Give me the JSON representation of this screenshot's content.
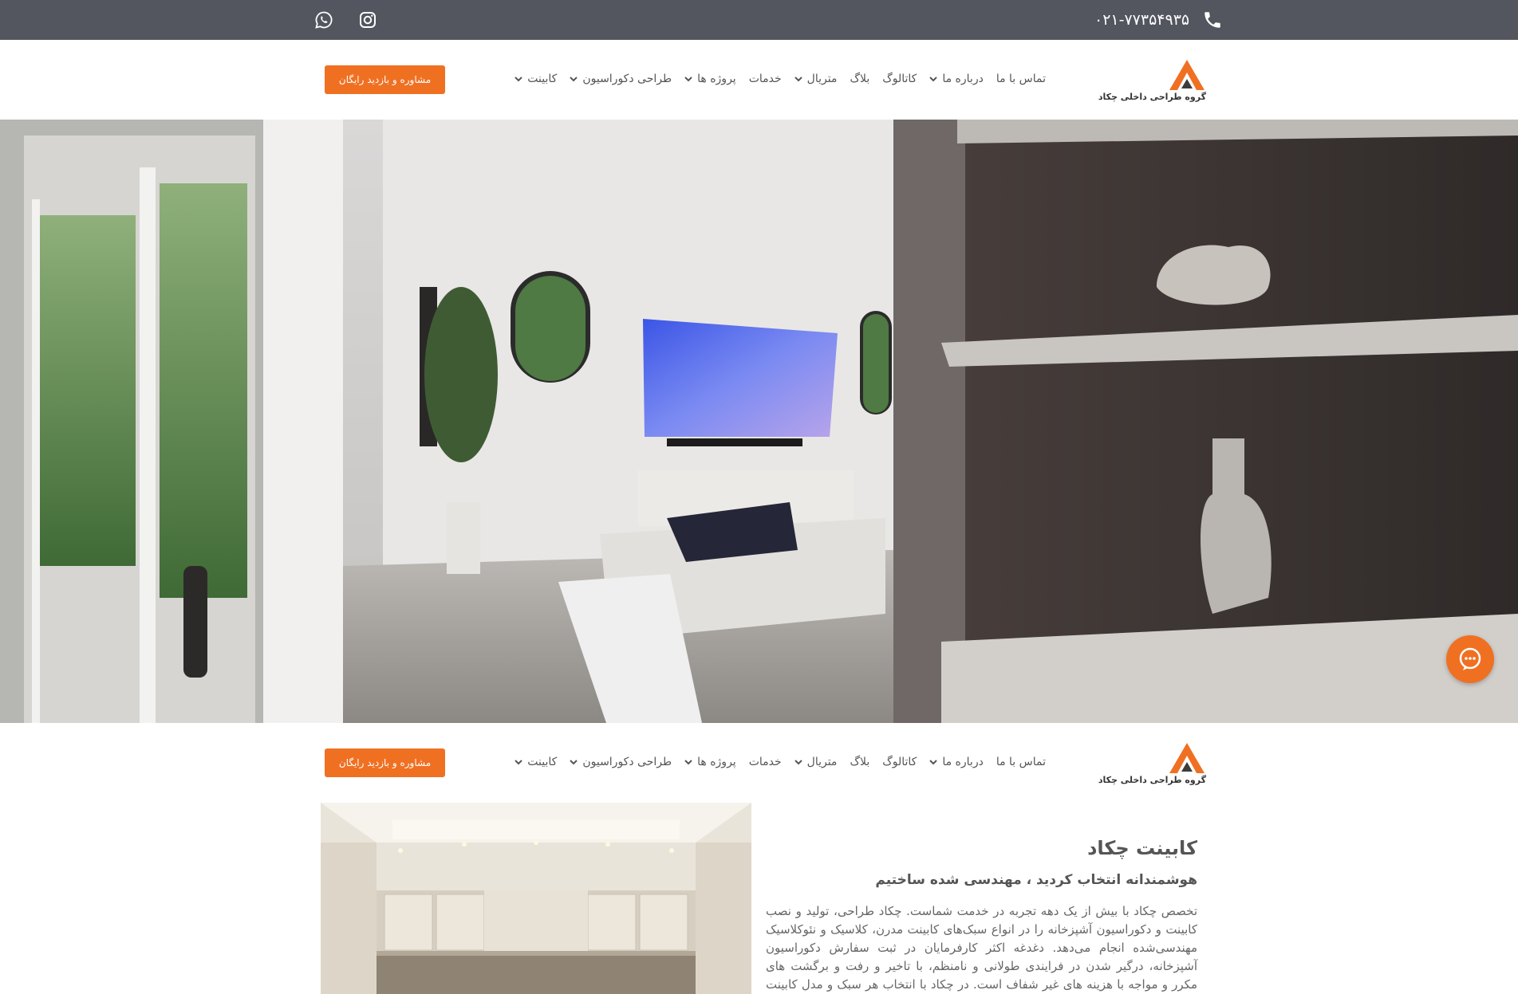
{
  "topbar": {
    "phone": "۰۲۱-۷۷۳۵۴۹۳۵",
    "phone_icon": "phone-icon",
    "social": [
      "instagram-icon",
      "whatsapp-icon"
    ]
  },
  "brand": {
    "name": "گروه طراحی داخلی چکاد",
    "accent": "#f07022"
  },
  "nav": {
    "items": [
      {
        "label": "کابینت",
        "has_dropdown": true
      },
      {
        "label": "طراحی دکوراسیون",
        "has_dropdown": true
      },
      {
        "label": "پروژه ها",
        "has_dropdown": true
      },
      {
        "label": "خدمات",
        "has_dropdown": false
      },
      {
        "label": "متریال",
        "has_dropdown": true
      },
      {
        "label": "بلاگ",
        "has_dropdown": false
      },
      {
        "label": "کاتالوگ",
        "has_dropdown": false
      },
      {
        "label": "درباره ما",
        "has_dropdown": true
      },
      {
        "label": "تماس با ما",
        "has_dropdown": false
      }
    ],
    "cta": "مشاوره و بازدید رایگان"
  },
  "section": {
    "title": "کابینت چکاد",
    "subtitle": "هوشمندانه انتخاب کردید ، مهندسی شده ساختیم",
    "body": "تخصص چکاد با بیش از یک دهه تجربه در خدمت شماست. چکاد طراحی، تولید و نصب کابینت و دکوراسیون آشپزخانه را در انواع سبک‌های کابینت مدرن، کلاسیک و نئوکلاسیک مهندسی‌شده انجام می‌دهد. دغدغه اکثر کارفرمایان در ثبت سفارش دکوراسیون آشپزخانه، درگیر شدن در فرایندی طولانی و نامنظم، با تاخیر و رفت و برگشت های مکرر و مواجه با هزینه های غیر شفاف است. در چکاد با انتخاب هر سبک و مدل کابینت فرآیند سفارش و"
  },
  "chat": {
    "icon": "chat-bubble-icon"
  }
}
